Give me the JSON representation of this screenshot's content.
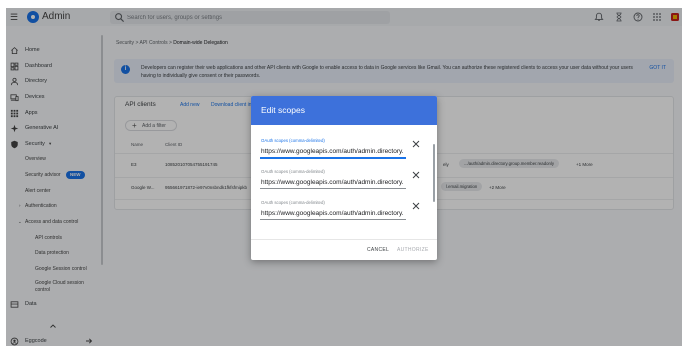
{
  "topbar": {
    "app_title": "Admin",
    "search_placeholder": "Search for users, groups or settings"
  },
  "sidebar": {
    "items": [
      {
        "label": "Home",
        "icon": "home-icon"
      },
      {
        "label": "Dashboard",
        "icon": "dashboard-icon"
      },
      {
        "label": "Directory",
        "icon": "person-icon"
      },
      {
        "label": "Devices",
        "icon": "devices-icon"
      },
      {
        "label": "Apps",
        "icon": "apps-grid-icon"
      },
      {
        "label": "Generative AI",
        "icon": "sparkle-icon"
      },
      {
        "label": "Security",
        "icon": "shield-icon"
      }
    ],
    "security_children": {
      "overview": "Overview",
      "security_advisor": "Security advisor",
      "new_badge": "NEW",
      "alert_center": "Alert center",
      "authentication": "Authentication",
      "access_and_data_control": "Access and data control",
      "api_controls": "API controls",
      "data_protection": "Data protection",
      "google_session_control": "Google Session control",
      "google_cloud_session_control": "Google Cloud session control"
    },
    "data_label": "Data",
    "user_name": "Eggcode"
  },
  "breadcrumb": {
    "security": "Security",
    "api_controls": "API Controls",
    "current": "Domain-wide Delegation",
    "separator": ">"
  },
  "banner": {
    "text": "Developers can register their web applications and other API clients with Google to enable access to data in Google services like Gmail. You can authorize these registered clients to access your user data without your users having to individually give consent or their passwords.",
    "action": "GOT IT"
  },
  "api_clients": {
    "title": "API clients",
    "add_new": "Add new",
    "download": "Download client info",
    "add_filter": "Add a filter",
    "columns": {
      "name": "Name",
      "client_id": "Client ID"
    },
    "rows": [
      {
        "name": "E3",
        "client_id": "108520107054755191745",
        "scope_fragment": "ely",
        "scope_chip": ".../auth/admin.directory.group.member.readonly",
        "more": "+1 More"
      },
      {
        "name": "Google W...",
        "client_id": "955661971872-ie97v0nsbndk1fkfsfmipkb",
        "scope_chip": "l.email.migration",
        "more": "+2 More"
      }
    ]
  },
  "dialog": {
    "title": "Edit scopes",
    "fields": [
      {
        "label": "OAuth scopes (comma-delimited)",
        "value": "https://www.googleapis.com/auth/admin.directory.",
        "active": true
      },
      {
        "label": "OAuth scopes (comma-delimited)",
        "value": "https://www.googleapis.com/auth/admin.directory.",
        "active": false
      },
      {
        "label": "OAuth scopes (comma-delimited)",
        "value": "https://www.googleapis.com/auth/admin.directory.",
        "active": false
      }
    ],
    "cancel": "CANCEL",
    "authorize": "AUTHORIZE"
  },
  "colors": {
    "accent": "#1a73e8",
    "dialog_header": "#3d71db",
    "disabled_text": "#a8abb0"
  }
}
